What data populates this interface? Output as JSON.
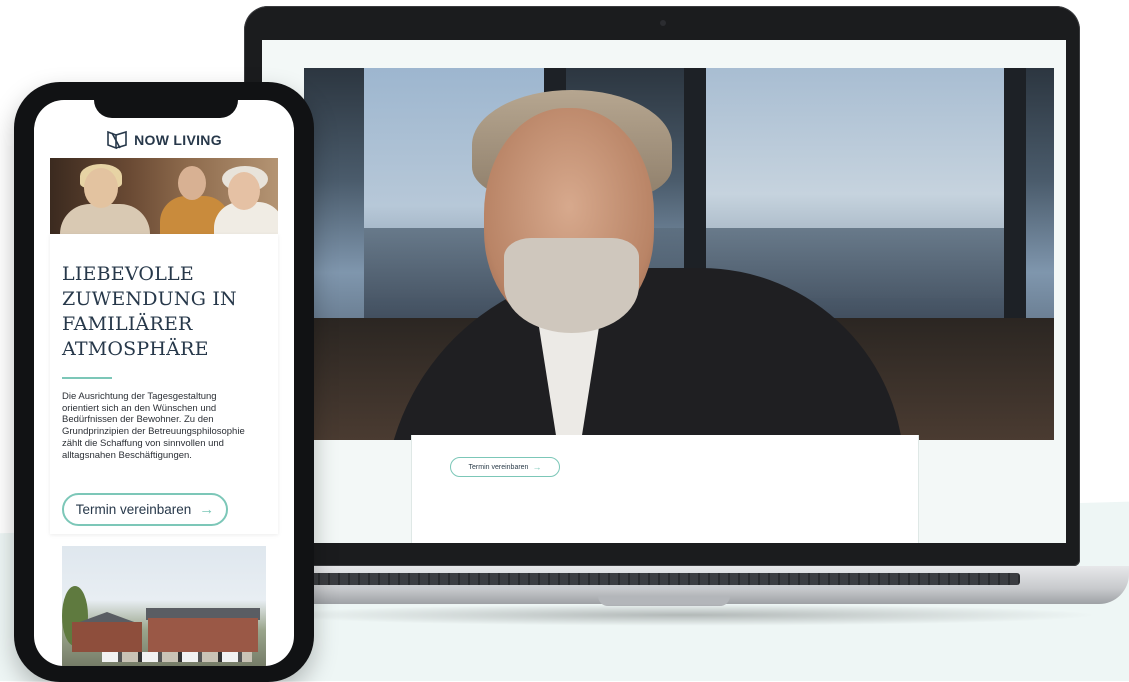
{
  "laptop": {
    "cta_label": "Termin vereinbaren",
    "cta_arrow": "→",
    "hero_image": "man-portrait-photo"
  },
  "phone": {
    "logo_text": "NOW LIVING",
    "logo_icon": "book-icon",
    "hero_image": "seniors-photo",
    "title_lines": [
      "LIEBEVOLLE",
      "ZUWENDUNG IN",
      "FAMILIÄRER",
      "ATMOSPHÄRE"
    ],
    "body_lines": [
      "Die Ausrichtung der Tagesgestaltung",
      "orientiert sich an den Wünschen und",
      "Bedürfnissen der Bewohner. Zu den",
      "Grundprinzipien der Betreuungsphilosophie",
      "zählt die Schaffung von sinnvollen und",
      "alltagsnahen Beschäftigungen."
    ],
    "cta_label": "Termin vereinbaren",
    "cta_arrow": "→",
    "building_image": "building-photo"
  },
  "colors": {
    "accent": "#7cc7b8",
    "heading": "#27384a",
    "background_tint": "#eef6f5"
  }
}
